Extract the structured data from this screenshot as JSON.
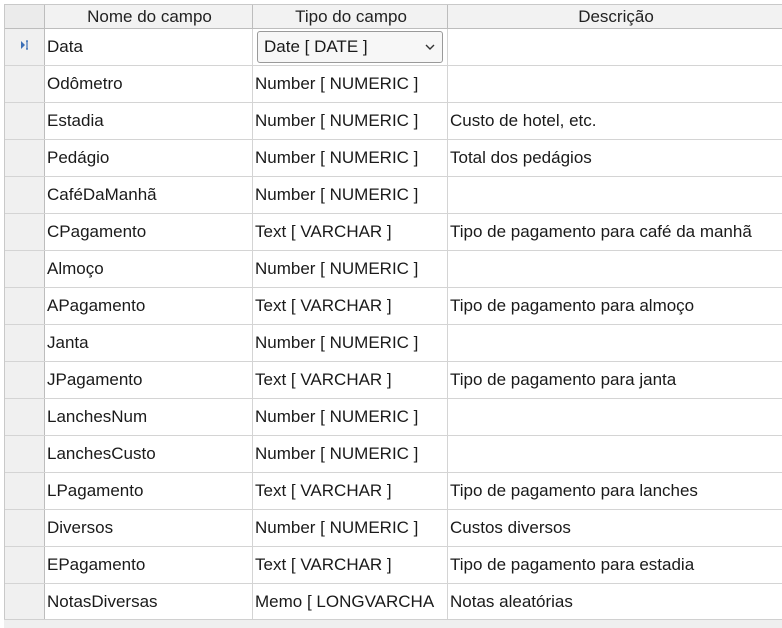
{
  "columns": {
    "name": "Nome do campo",
    "type": "Tipo do campo",
    "description": "Descrição"
  },
  "current_row_icon": "edit-cursor-icon",
  "rows": [
    {
      "name": "Data",
      "type": "Date [ DATE ]",
      "description": ""
    },
    {
      "name": "Odômetro",
      "type": "Number [ NUMERIC ]",
      "description": ""
    },
    {
      "name": "Estadia",
      "type": "Number [ NUMERIC ]",
      "description": "Custo de hotel, etc."
    },
    {
      "name": "Pedágio",
      "type": "Number [ NUMERIC ]",
      "description": "Total dos pedágios"
    },
    {
      "name": "CaféDaManhã",
      "type": "Number [ NUMERIC ]",
      "description": ""
    },
    {
      "name": "CPagamento",
      "type": "Text [ VARCHAR ]",
      "description": "Tipo de pagamento para café da manhã"
    },
    {
      "name": "Almoço",
      "type": "Number [ NUMERIC ]",
      "description": ""
    },
    {
      "name": "APagamento",
      "type": "Text [ VARCHAR ]",
      "description": "Tipo de pagamento para almoço"
    },
    {
      "name": "Janta",
      "type": "Number [ NUMERIC ]",
      "description": ""
    },
    {
      "name": "JPagamento",
      "type": "Text [ VARCHAR ]",
      "description": "Tipo de pagamento para janta"
    },
    {
      "name": "LanchesNum",
      "type": "Number [ NUMERIC ]",
      "description": ""
    },
    {
      "name": "LanchesCusto",
      "type": "Number [ NUMERIC ]",
      "description": ""
    },
    {
      "name": "LPagamento",
      "type": "Text [ VARCHAR ]",
      "description": "Tipo de pagamento para lanches"
    },
    {
      "name": "Diversos",
      "type": "Number [ NUMERIC ]",
      "description": "Custos diversos"
    },
    {
      "name": "EPagamento",
      "type": "Text [ VARCHAR ]",
      "description": "Tipo de pagamento para estadia"
    },
    {
      "name": "NotasDiversas",
      "type": "Memo [ LONGVARCHA",
      "description": "Notas aleatórias"
    }
  ]
}
